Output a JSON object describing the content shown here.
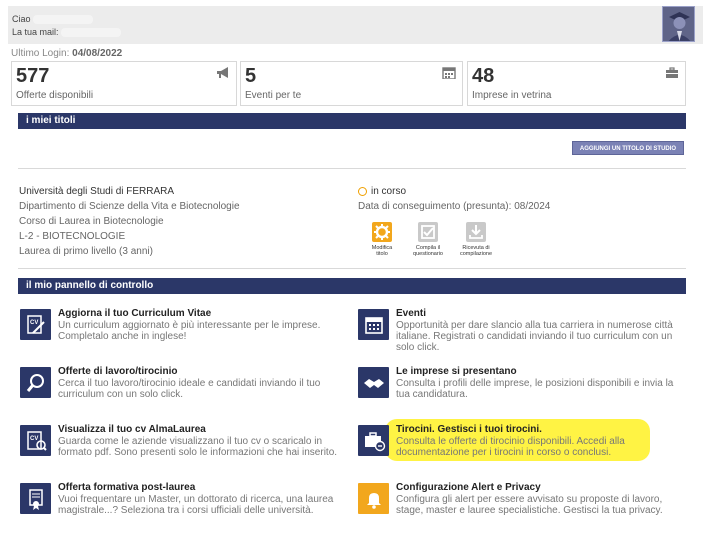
{
  "header": {
    "greeting_label": "Ciao",
    "mail_label": "La tua mail:"
  },
  "last_login": {
    "label": "Ultimo Login:",
    "date": "04/08/2022"
  },
  "stats": [
    {
      "value": "577",
      "label": "Offerte disponibili",
      "icon": "megaphone-icon"
    },
    {
      "value": "5",
      "label": "Eventi per te",
      "icon": "calendar-icon"
    },
    {
      "value": "48",
      "label": "Imprese in vetrina",
      "icon": "briefcase-icon"
    }
  ],
  "titles_section": {
    "header": "i miei titoli",
    "add_button": "AGGIUNGI UN TITOLO DI STUDIO",
    "university": "Università degli Studi di FERRARA",
    "department": "Dipartimento di Scienze della Vita e Biotecnologie",
    "course": "Corso di Laurea in Biotecnologie",
    "class": "L-2 - BIOTECNOLOGIE",
    "level": "Laurea di primo livello (3 anni)",
    "status": "in corso",
    "date_label": "Data di conseguimento (presunta): 08/2024",
    "actions": [
      {
        "label_l1": "Modifica",
        "label_l2": "titolo"
      },
      {
        "label_l1": "Compila il",
        "label_l2": "questionario"
      },
      {
        "label_l1": "Ricevuta di",
        "label_l2": "compilazione"
      }
    ]
  },
  "panel": {
    "header": "il mio pannello di controllo",
    "items": [
      {
        "title": "Aggiorna il tuo Curriculum Vitae",
        "desc": "Un curriculum aggiornato è più interessante per le imprese. Completalo anche in inglese!",
        "icon": "cv-edit-icon"
      },
      {
        "title": "Eventi",
        "desc": "Opportunità per dare slancio alla tua carriera in numerose città italiane. Registrati o candidati inviando il tuo curriculum con un solo click.",
        "icon": "calendar-icon"
      },
      {
        "title": "Offerte di lavoro/tirocinio",
        "desc": "Cerca il tuo lavoro/tirocinio ideale e candidati inviando il tuo curriculum con un solo click.",
        "icon": "magnifier-icon"
      },
      {
        "title": "Le imprese si presentano",
        "desc": "Consulta i profili delle imprese, le posizioni disponibili e invia la tua candidatura.",
        "icon": "handshake-icon"
      },
      {
        "title": "Visualizza il tuo cv AlmaLaurea",
        "desc": "Guarda come le aziende visualizzano il tuo cv o scaricalo in formato pdf. Sono presenti solo le informazioni che hai inserito.",
        "icon": "cv-view-icon"
      },
      {
        "title": "Tirocini. Gestisci i tuoi tirocini.",
        "desc": "Consulta le offerte di tirocinio disponibili. Accedi alla documentazione per i tirocini in corso o conclusi.",
        "icon": "internship-briefcase-icon"
      },
      {
        "title": "Offerta formativa post-laurea",
        "desc": "Vuoi frequentare un Master, un dottorato di ricerca, una laurea magistrale...? Seleziona tra i corsi ufficiali delle università.",
        "icon": "diploma-icon"
      },
      {
        "title": "Configurazione Alert e Privacy",
        "desc": "Configura gli alert per essere avvisato su proposte di lavoro, stage, master e lauree specialistiche. Gestisci la tua privacy.",
        "icon": "bell-icon"
      }
    ]
  },
  "colors": {
    "navy": "#2b3768",
    "orange": "#f2a71d",
    "highlight": "#fff23a"
  }
}
